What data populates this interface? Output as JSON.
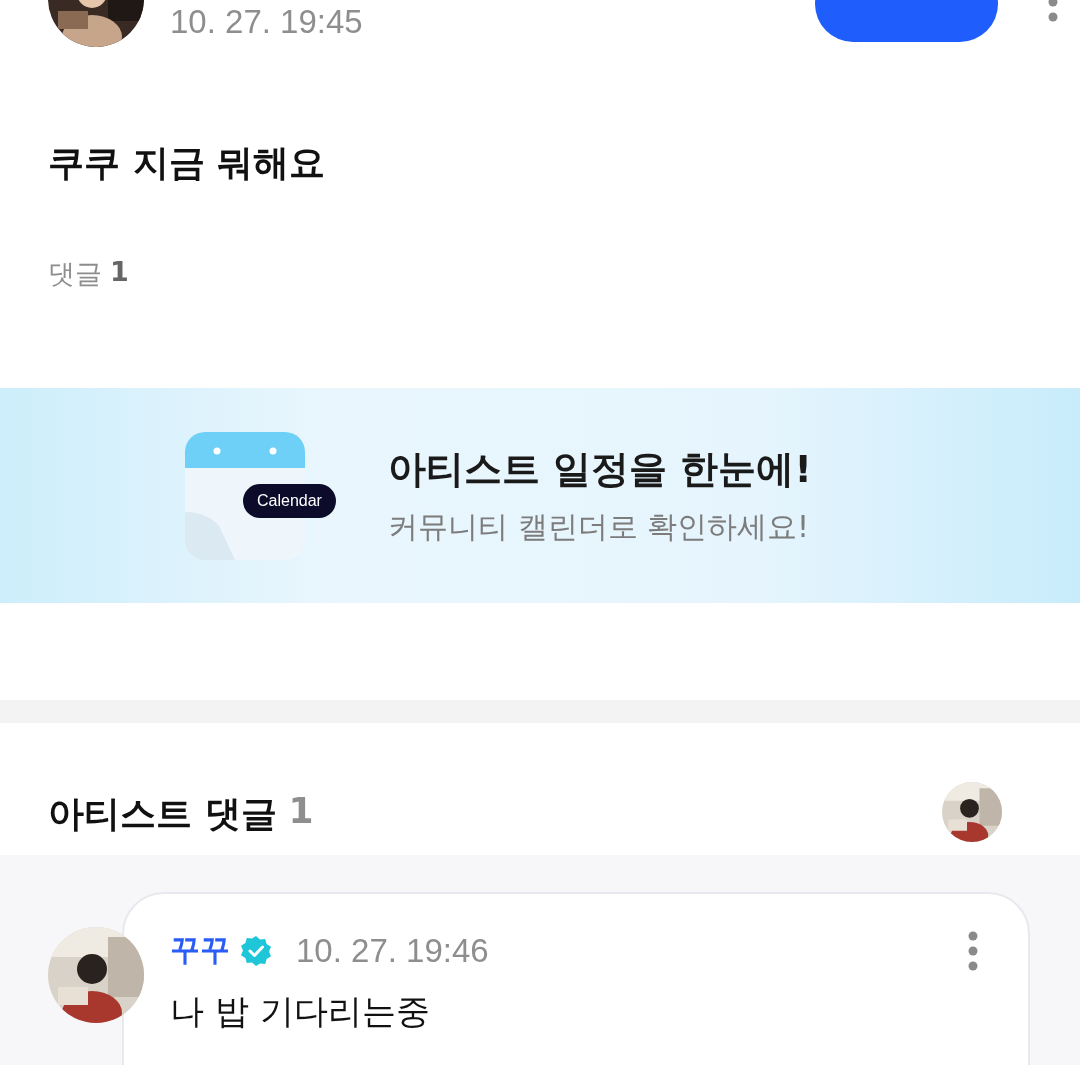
{
  "post": {
    "time": "10. 27. 19:45",
    "follow_button": {
      "kind": "follow"
    },
    "text": "쿠쿠 지금 뭐해요",
    "comments_label": "댓글",
    "comments_count": "1"
  },
  "banner": {
    "badge": "Calendar",
    "title": "아티스트 일정을 한눈에!",
    "subtitle": "커뮤니티 캘린더로 확인하세요!"
  },
  "artist_comments": {
    "title": "아티스트 댓글",
    "count": "1",
    "comments": [
      {
        "author": "꾸꾸",
        "verified": true,
        "time": "10. 27. 19:46",
        "text": "나 밥 기다리는중"
      }
    ]
  }
}
